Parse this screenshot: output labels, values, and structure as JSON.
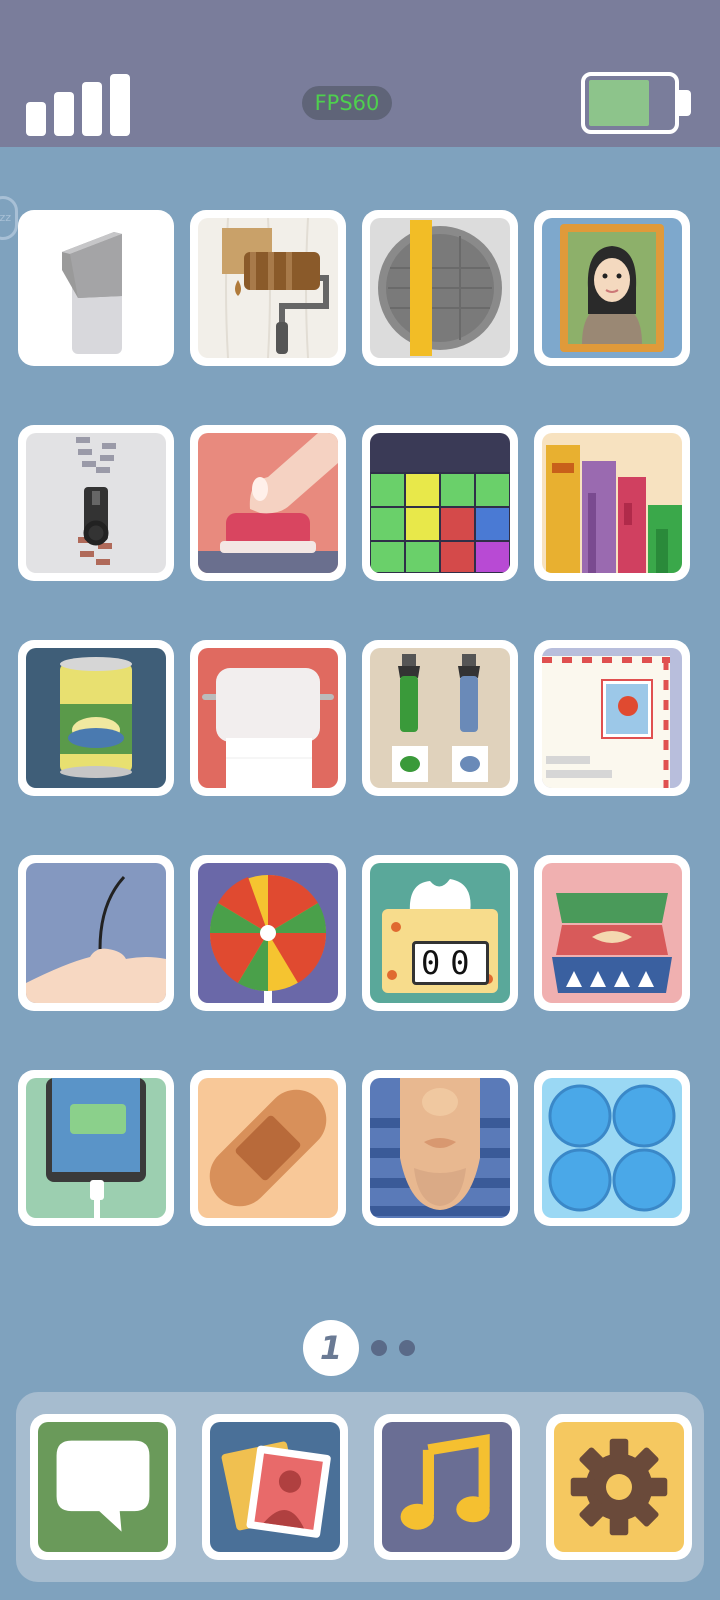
{
  "status_bar": {
    "fps_label": "FPS60",
    "signal_bars": 4,
    "battery_level": 0.65,
    "fps_color": "#4ed04e"
  },
  "sleep_badge": "zz",
  "levels": [
    {
      "icon": "light-switch-icon"
    },
    {
      "icon": "paint-roller-icon"
    },
    {
      "icon": "manhole-cover-icon"
    },
    {
      "icon": "mona-lisa-painting-icon"
    },
    {
      "icon": "zipper-icon"
    },
    {
      "icon": "push-button-icon"
    },
    {
      "icon": "block-puzzle-icon"
    },
    {
      "icon": "bookshelf-icon"
    },
    {
      "icon": "soup-can-icon"
    },
    {
      "icon": "toilet-paper-icon"
    },
    {
      "icon": "paint-tubes-icon"
    },
    {
      "icon": "airmail-letter-icon"
    },
    {
      "icon": "hair-strand-icon"
    },
    {
      "icon": "lollipop-icon"
    },
    {
      "icon": "tissue-box-icon",
      "counter": "00"
    },
    {
      "icon": "stacked-bowls-icon"
    },
    {
      "icon": "phone-charging-icon"
    },
    {
      "icon": "bandage-icon"
    },
    {
      "icon": "face-shave-icon"
    },
    {
      "icon": "bubble-wrap-icon"
    }
  ],
  "pager": {
    "current": "1",
    "total_dots": 3
  },
  "dock": [
    {
      "icon": "messages-icon"
    },
    {
      "icon": "photos-icon"
    },
    {
      "icon": "music-icon"
    },
    {
      "icon": "settings-icon"
    }
  ]
}
